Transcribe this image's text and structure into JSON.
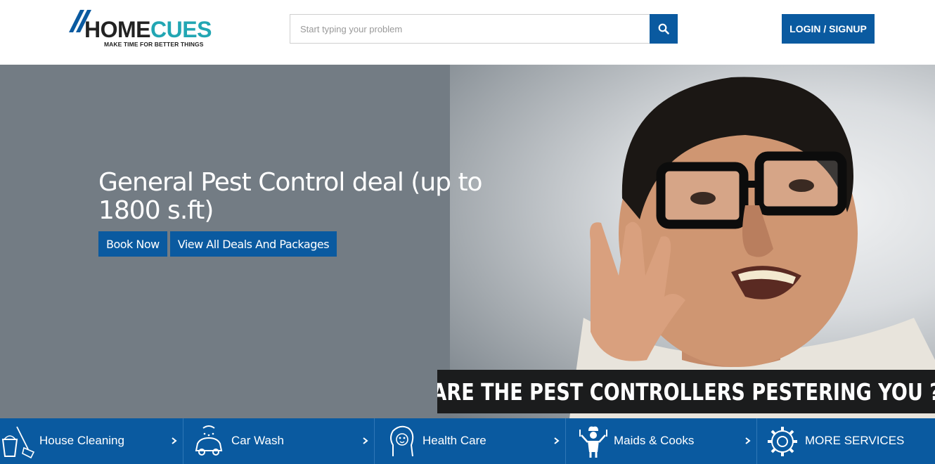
{
  "header": {
    "logo": {
      "home": "HOME",
      "cues": "CUES",
      "tagline": "MAKE TIME FOR BETTER THINGS"
    },
    "search": {
      "placeholder": "Start typing your problem",
      "icon": "search-icon"
    },
    "login_label": "LOGIN / SIGNUP"
  },
  "hero": {
    "title": "General Pest Control deal (up to 1800 s.ft)",
    "buttons": {
      "book": "Book Now",
      "deals": "View All Deals And Packages"
    },
    "banner": "ARE THE PEST CONTROLLERS PESTERING YOU ?"
  },
  "services": [
    {
      "label": "House Cleaning",
      "icon": "bucket-broom-icon"
    },
    {
      "label": "Car Wash",
      "icon": "car-wash-icon"
    },
    {
      "label": "Health Care",
      "icon": "health-care-icon"
    },
    {
      "label": "Maids & Cooks",
      "icon": "chef-icon"
    },
    {
      "label": "MORE SERVICES",
      "icon": "gear-icon"
    }
  ],
  "colors": {
    "brand_blue": "#0a5aa0",
    "logo_teal": "#22a6b3",
    "hero_grey": "#737c84"
  }
}
